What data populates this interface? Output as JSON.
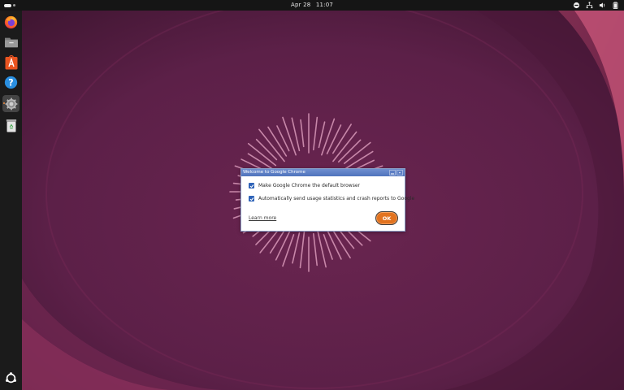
{
  "topbar": {
    "date": "Apr 28",
    "time": "11:07",
    "tray_icons": [
      "do-not-disturb-icon",
      "network-icon",
      "volume-icon",
      "battery-icon"
    ]
  },
  "dock": {
    "items": [
      {
        "name": "firefox-icon",
        "active": false
      },
      {
        "name": "files-icon",
        "active": false
      },
      {
        "name": "app-center-icon",
        "active": false
      },
      {
        "name": "help-icon",
        "active": false
      },
      {
        "name": "settings-icon",
        "active": true
      },
      {
        "name": "trash-icon",
        "active": false
      }
    ],
    "bottom": "show-apps-icon"
  },
  "dialog": {
    "title": "Welcome to Google Chrome",
    "options": [
      {
        "label": "Make Google Chrome the default browser",
        "checked": true
      },
      {
        "label": "Automatically send usage statistics and crash reports to Google",
        "checked": true
      }
    ],
    "learn_more": "Learn more",
    "ok": "OK"
  },
  "colors": {
    "wallpaper": "#5a1f44",
    "accent": "#e2731f",
    "checkbox": "#2e63b8",
    "titlebar": "#5a7cc4"
  }
}
